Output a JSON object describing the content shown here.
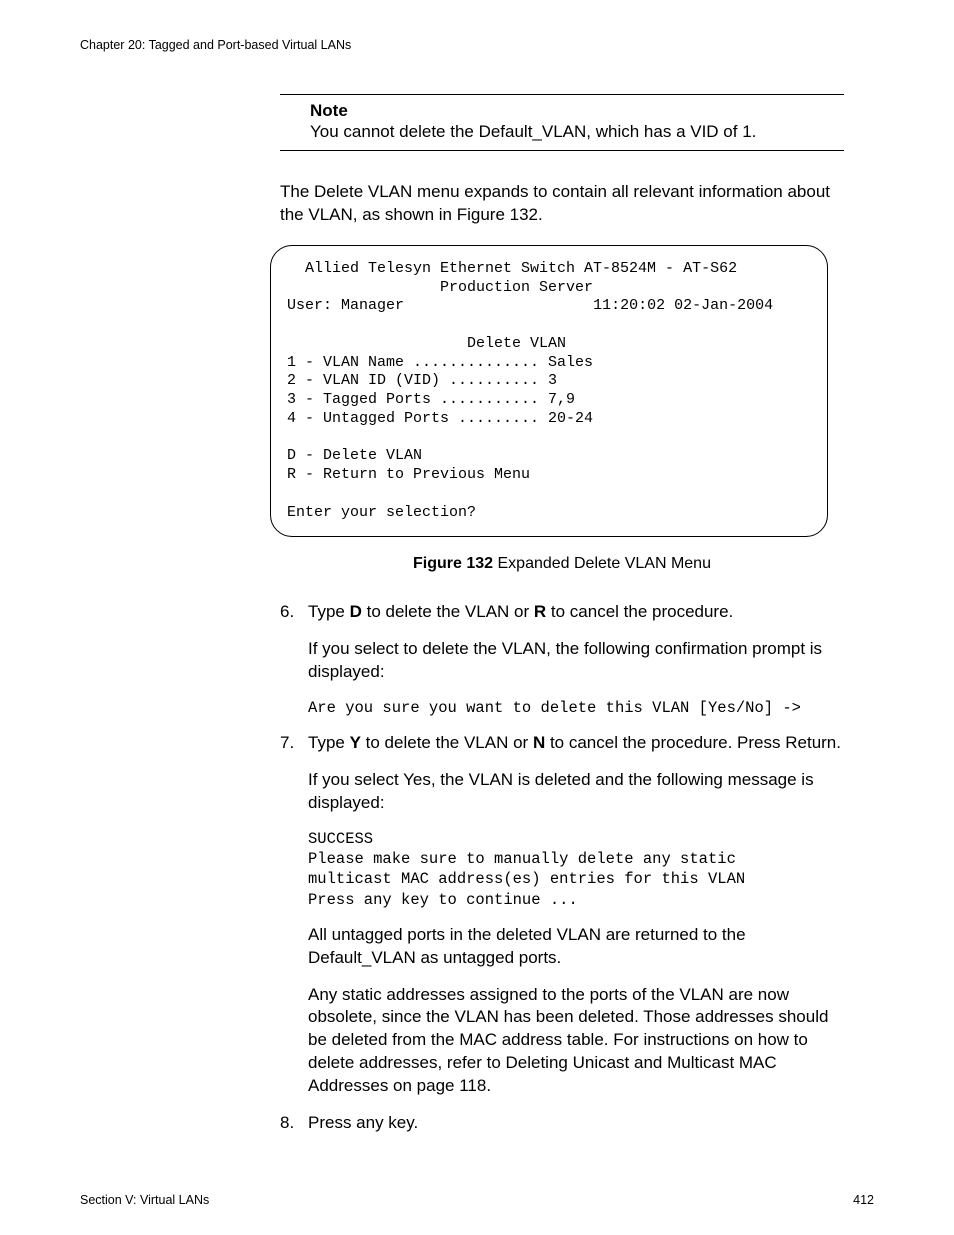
{
  "header": {
    "chapter": "Chapter 20: Tagged and Port-based Virtual LANs"
  },
  "note": {
    "title": "Note",
    "body": "You cannot delete the Default_VLAN, which has a VID of 1."
  },
  "intro_para": "The Delete VLAN menu expands to contain all relevant information about the VLAN, as shown in Figure 132.",
  "terminal": {
    "line1": "  Allied Telesyn Ethernet Switch AT-8524M - AT-S62",
    "line2": "                 Production Server",
    "user_label": "User: Manager",
    "timestamp": "11:20:02 02-Jan-2004",
    "menu_title": "Delete VLAN",
    "items": {
      "i1": "1 - VLAN Name .............. Sales",
      "i2": "2 - VLAN ID (VID) .......... 3",
      "i3": "3 - Tagged Ports ........... 7,9",
      "i4": "4 - Untagged Ports ......... 20-24",
      "d": "D - Delete VLAN",
      "r": "R - Return to Previous Menu"
    },
    "prompt": "Enter your selection?"
  },
  "figure": {
    "label": "Figure 132",
    "caption": "  Expanded Delete VLAN Menu"
  },
  "steps": {
    "s6": {
      "num": "6.",
      "p1a": "Type ",
      "p1b": "D",
      "p1c": " to delete the VLAN or ",
      "p1d": "R",
      "p1e": " to cancel the procedure.",
      "p2": "If you select to delete the VLAN, the following confirmation prompt is displayed:",
      "code": "Are you sure you want to delete this VLAN [Yes/No] ->"
    },
    "s7": {
      "num": "7.",
      "p1a": "Type ",
      "p1b": "Y",
      "p1c": " to delete the VLAN or ",
      "p1d": "N",
      "p1e": " to cancel the procedure. Press Return.",
      "p2": "If you select Yes, the VLAN is deleted and the following message is displayed:",
      "code": "SUCCESS\nPlease make sure to manually delete any static\nmulticast MAC address(es) entries for this VLAN\nPress any key to continue ...",
      "p3": "All untagged ports in the deleted VLAN are returned to the Default_VLAN as untagged ports.",
      "p4": "Any static addresses assigned to the ports of the VLAN are now obsolete, since the VLAN has been deleted. Those addresses should be deleted from the MAC address table. For instructions on how to delete addresses, refer to Deleting Unicast and Multicast MAC Addresses on page 118."
    },
    "s8": {
      "num": "8.",
      "p1": "Press any key."
    }
  },
  "footer": {
    "section": "Section V: Virtual LANs",
    "page": "412"
  }
}
